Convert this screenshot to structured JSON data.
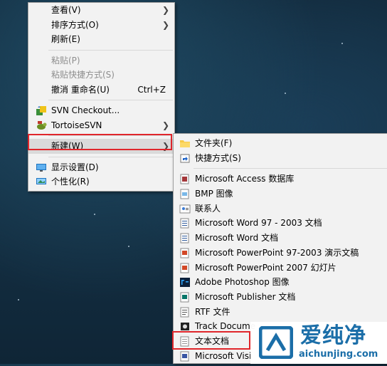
{
  "context_menu": {
    "items": [
      {
        "label": "查看(V)"
      },
      {
        "label": "排序方式(O)"
      },
      {
        "label": "刷新(E)"
      },
      {
        "label": "粘贴(P)"
      },
      {
        "label": "粘贴快捷方式(S)"
      },
      {
        "label": "撤消 重命名(U)",
        "shortcut": "Ctrl+Z"
      },
      {
        "label": "SVN Checkout..."
      },
      {
        "label": "TortoiseSVN"
      },
      {
        "label": "新建(W)"
      },
      {
        "label": "显示设置(D)"
      },
      {
        "label": "个性化(R)"
      }
    ]
  },
  "new_submenu": {
    "items": [
      {
        "label": "文件夹(F)"
      },
      {
        "label": "快捷方式(S)"
      },
      {
        "label": "Microsoft Access 数据库"
      },
      {
        "label": "BMP 图像"
      },
      {
        "label": "联系人"
      },
      {
        "label": "Microsoft Word 97 - 2003 文档"
      },
      {
        "label": "Microsoft Word 文档"
      },
      {
        "label": "Microsoft PowerPoint 97-2003 演示文稿"
      },
      {
        "label": "Microsoft PowerPoint 2007 幻灯片"
      },
      {
        "label": "Adobe Photoshop 图像"
      },
      {
        "label": "Microsoft Publisher 文档"
      },
      {
        "label": "RTF 文件"
      },
      {
        "label": "Track Docume"
      },
      {
        "label": "文本文档"
      },
      {
        "label": "Microsoft Visi"
      }
    ]
  },
  "watermark": {
    "text": "爱纯净",
    "url": "aichunjing.com"
  },
  "colors": {
    "highlight_border": "#e0262b",
    "menu_bg": "#f2f2f2",
    "watermark_blue": "#1b6ea8"
  }
}
